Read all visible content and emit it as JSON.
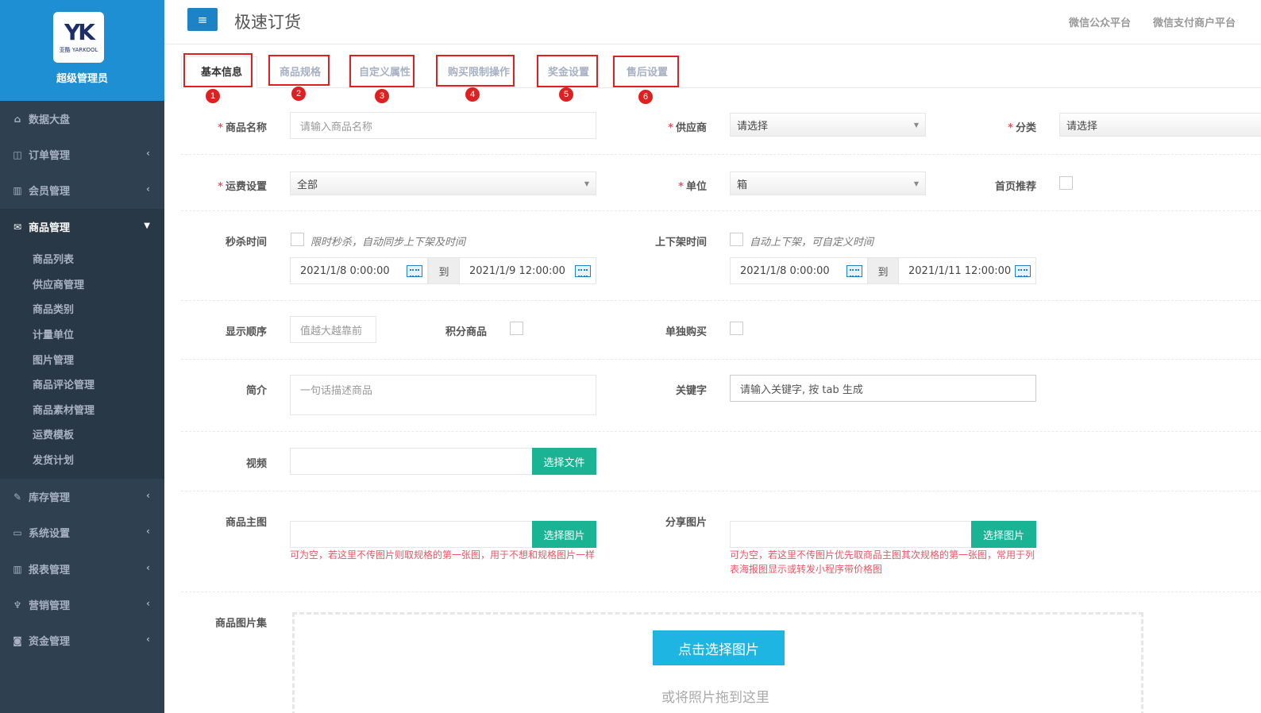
{
  "sidebar": {
    "logo_mark": "YK",
    "logo_brand": "亚酷 YARKOOL",
    "admin_name": "超级管理员",
    "items": [
      {
        "label": "数据大盘",
        "icon": "home-icon"
      },
      {
        "label": "订单管理",
        "icon": "columns-icon"
      },
      {
        "label": "会员管理",
        "icon": "bar-chart-icon"
      },
      {
        "label": "商品管理",
        "icon": "envelope-icon"
      },
      {
        "label": "库存管理",
        "icon": "edit-icon"
      },
      {
        "label": "系统设置",
        "icon": "desktop-icon"
      },
      {
        "label": "报表管理",
        "icon": "bar-chart-icon"
      },
      {
        "label": "营销管理",
        "icon": "cutlery-icon"
      },
      {
        "label": "资金管理",
        "icon": "money-icon"
      }
    ],
    "subitems": [
      "商品列表",
      "供应商管理",
      "商品类别",
      "计量单位",
      "图片管理",
      "商品评论管理",
      "商品素材管理",
      "运费模板",
      "发货计划"
    ]
  },
  "header": {
    "menu_icon": "≡",
    "title": "极速订货",
    "link1": "微信公众平台",
    "link2": "微信支付商户平台"
  },
  "tabs": [
    "基本信息",
    "商品规格",
    "自定义属性",
    "购买限制操作",
    "奖金设置",
    "售后设置"
  ],
  "badges": [
    "1",
    "2",
    "3",
    "4",
    "5",
    "6"
  ],
  "form": {
    "name_label": "商品名称",
    "name_placeholder": "请输入商品名称",
    "supplier_label": "供应商",
    "supplier_value": "请选择",
    "category_label": "分类",
    "category_value": "请选择",
    "freight_label": "运费设置",
    "freight_value": "全部",
    "unit_label": "单位",
    "unit_value": "箱",
    "home_rec_label": "首页推荐",
    "flash_label": "秒杀时间",
    "flash_hint": "限时秒杀，自动同步上下架及时间",
    "flash_start": "2021/1/8 0:00:00",
    "flash_to": "到",
    "flash_end": "2021/1/9 12:00:00",
    "shelf_label": "上下架时间",
    "shelf_hint": "自动上下架，可自定义时间",
    "shelf_start": "2021/1/8 0:00:00",
    "shelf_to": "到",
    "shelf_end": "2021/1/11 12:00:00",
    "order_label": "显示顺序",
    "order_placeholder": "值越大越靠前",
    "points_label": "积分商品",
    "single_label": "单独购买",
    "intro_label": "简介",
    "intro_placeholder": "一句话描述商品",
    "keyword_label": "关键字",
    "keyword_placeholder": "请输入关键字, 按 tab 生成",
    "video_label": "视频",
    "video_btn": "选择文件",
    "main_img_label": "商品主图",
    "main_img_btn": "选择图片",
    "main_img_note": "可为空，若这里不传图片则取规格的第一张图，用于不想和规格图片一样",
    "share_img_label": "分享图片",
    "share_img_btn": "选择图片",
    "share_img_note": "可为空，若这里不传图片优先取商品主图其次规格的第一张图，常用于列表海报图显示或转发小程序带价格图",
    "gallery_label": "商品图片集",
    "gallery_btn": "点击选择图片",
    "gallery_hint": "或将照片拖到这里"
  }
}
